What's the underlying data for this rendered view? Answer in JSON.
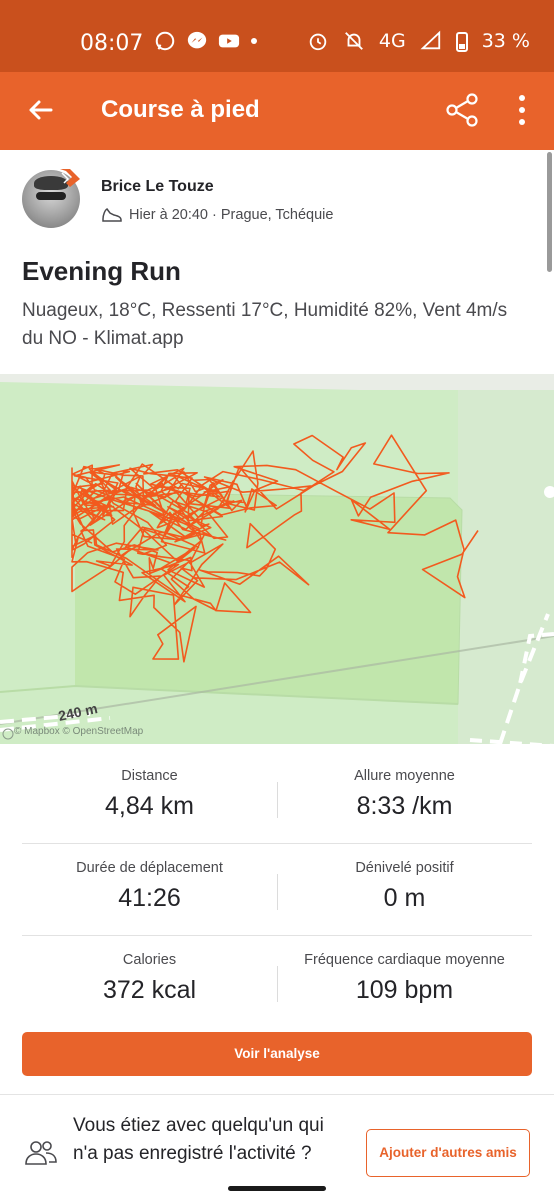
{
  "status_bar": {
    "time": "08:07",
    "network": "4G",
    "battery": "33 %",
    "left_icons": [
      "whatsapp-icon",
      "messenger-icon",
      "youtube-icon",
      "dot-icon"
    ],
    "right_icons": [
      "alarm-icon",
      "mute-icon",
      "signal-icon",
      "battery-icon"
    ]
  },
  "header": {
    "title": "Course à pied",
    "color": "#e8632b"
  },
  "athlete": {
    "name": "Brice Le Touze",
    "meta": "Hier à 20:40 · Prague, Tchéquie"
  },
  "activity": {
    "title": "Evening Run",
    "description": "Nuageux, 18°C, Ressenti 17°C, Humidité 82%, Vent 4m/s du NO - Klimat.app"
  },
  "map": {
    "attribution": "© Mapbox © OpenStreetMap",
    "scale_label": "240 m",
    "route_color": "#f25a1e"
  },
  "stats": [
    {
      "label": "Distance",
      "value": "4,84 km"
    },
    {
      "label": "Allure moyenne",
      "value": "8:33 /km"
    },
    {
      "label": "Durée de déplacement",
      "value": "41:26"
    },
    {
      "label": "Dénivelé positif",
      "value": "0 m"
    },
    {
      "label": "Calories",
      "value": "372 kcal"
    },
    {
      "label": "Fréquence cardiaque moyenne",
      "value": "109 bpm"
    }
  ],
  "analysis_button": "Voir l'analyse",
  "friends": {
    "text": "Vous étiez avec quelqu'un qui n'a pas enregistré l'activité ?",
    "button": "Ajouter d'autres amis"
  }
}
